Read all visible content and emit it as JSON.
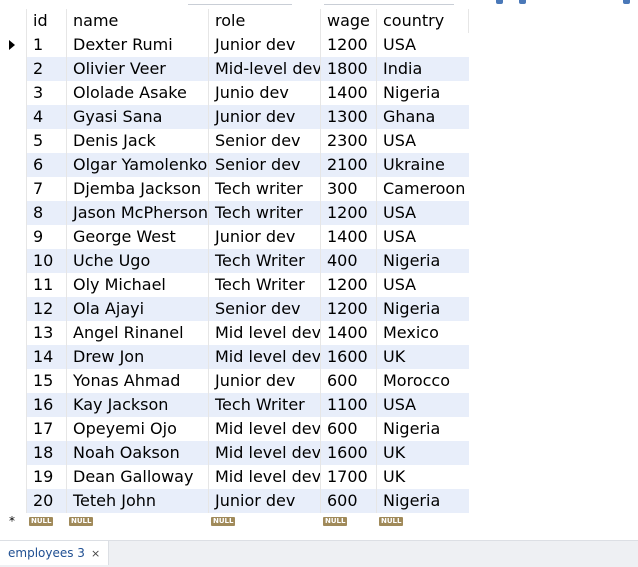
{
  "grid": {
    "columns": {
      "id": "id",
      "name": "name",
      "role": "role",
      "wage": "wage",
      "country": "country"
    },
    "rows": [
      {
        "id": "1",
        "name": "Dexter Rumi",
        "role": "Junior dev",
        "wage": "1200",
        "country": "USA"
      },
      {
        "id": "2",
        "name": "Olivier Veer",
        "role": "Mid-level dev",
        "wage": "1800",
        "country": "India"
      },
      {
        "id": "3",
        "name": "Ololade Asake",
        "role": "Junio dev",
        "wage": "1400",
        "country": "Nigeria"
      },
      {
        "id": "4",
        "name": "Gyasi Sana",
        "role": "Junior dev",
        "wage": "1300",
        "country": "Ghana"
      },
      {
        "id": "5",
        "name": "Denis Jack",
        "role": "Senior dev",
        "wage": "2300",
        "country": "USA"
      },
      {
        "id": "6",
        "name": "Olgar Yamolenko",
        "role": "Senior dev",
        "wage": "2100",
        "country": "Ukraine"
      },
      {
        "id": "7",
        "name": "Djemba Jackson",
        "role": "Tech writer",
        "wage": "300",
        "country": "Cameroon"
      },
      {
        "id": "8",
        "name": "Jason McPherson",
        "role": "Tech writer",
        "wage": "1200",
        "country": "USA"
      },
      {
        "id": "9",
        "name": "George West",
        "role": "Junior dev",
        "wage": "1400",
        "country": "USA"
      },
      {
        "id": "10",
        "name": "Uche Ugo",
        "role": "Tech Writer",
        "wage": "400",
        "country": "Nigeria"
      },
      {
        "id": "11",
        "name": "Oly Michael",
        "role": "Tech Writer",
        "wage": "1200",
        "country": "USA"
      },
      {
        "id": "12",
        "name": "Ola Ajayi",
        "role": "Senior dev",
        "wage": "1200",
        "country": "Nigeria"
      },
      {
        "id": "13",
        "name": "Angel Rinanel",
        "role": "Mid level dev",
        "wage": "1400",
        "country": "Mexico"
      },
      {
        "id": "14",
        "name": "Drew Jon",
        "role": "Mid level dev",
        "wage": "1600",
        "country": "UK"
      },
      {
        "id": "15",
        "name": "Yonas Ahmad",
        "role": "Junior dev",
        "wage": "600",
        "country": "Morocco"
      },
      {
        "id": "16",
        "name": "Kay Jackson",
        "role": "Tech Writer",
        "wage": "1100",
        "country": "USA"
      },
      {
        "id": "17",
        "name": "Opeyemi Ojo",
        "role": "Mid level dev",
        "wage": "600",
        "country": "Nigeria"
      },
      {
        "id": "18",
        "name": "Noah Oakson",
        "role": "Mid level dev",
        "wage": "1600",
        "country": "UK"
      },
      {
        "id": "19",
        "name": "Dean Galloway",
        "role": "Mid level dev",
        "wage": "1700",
        "country": "UK"
      },
      {
        "id": "20",
        "name": "Teteh John",
        "role": "Junior dev",
        "wage": "600",
        "country": "Nigeria"
      }
    ],
    "new_row": {
      "marker": "*",
      "null_label": "NULL"
    }
  },
  "tabs": [
    {
      "label": "employees 3",
      "close": "×"
    }
  ],
  "icons": {
    "current_row": "row-pointer-icon",
    "new_row": "new-row-star-icon",
    "close_tab": "close-icon"
  },
  "colors": {
    "alt_row": "#e8eefa",
    "tab_text": "#1f4f92",
    "null_badge": "#a08a5a"
  }
}
